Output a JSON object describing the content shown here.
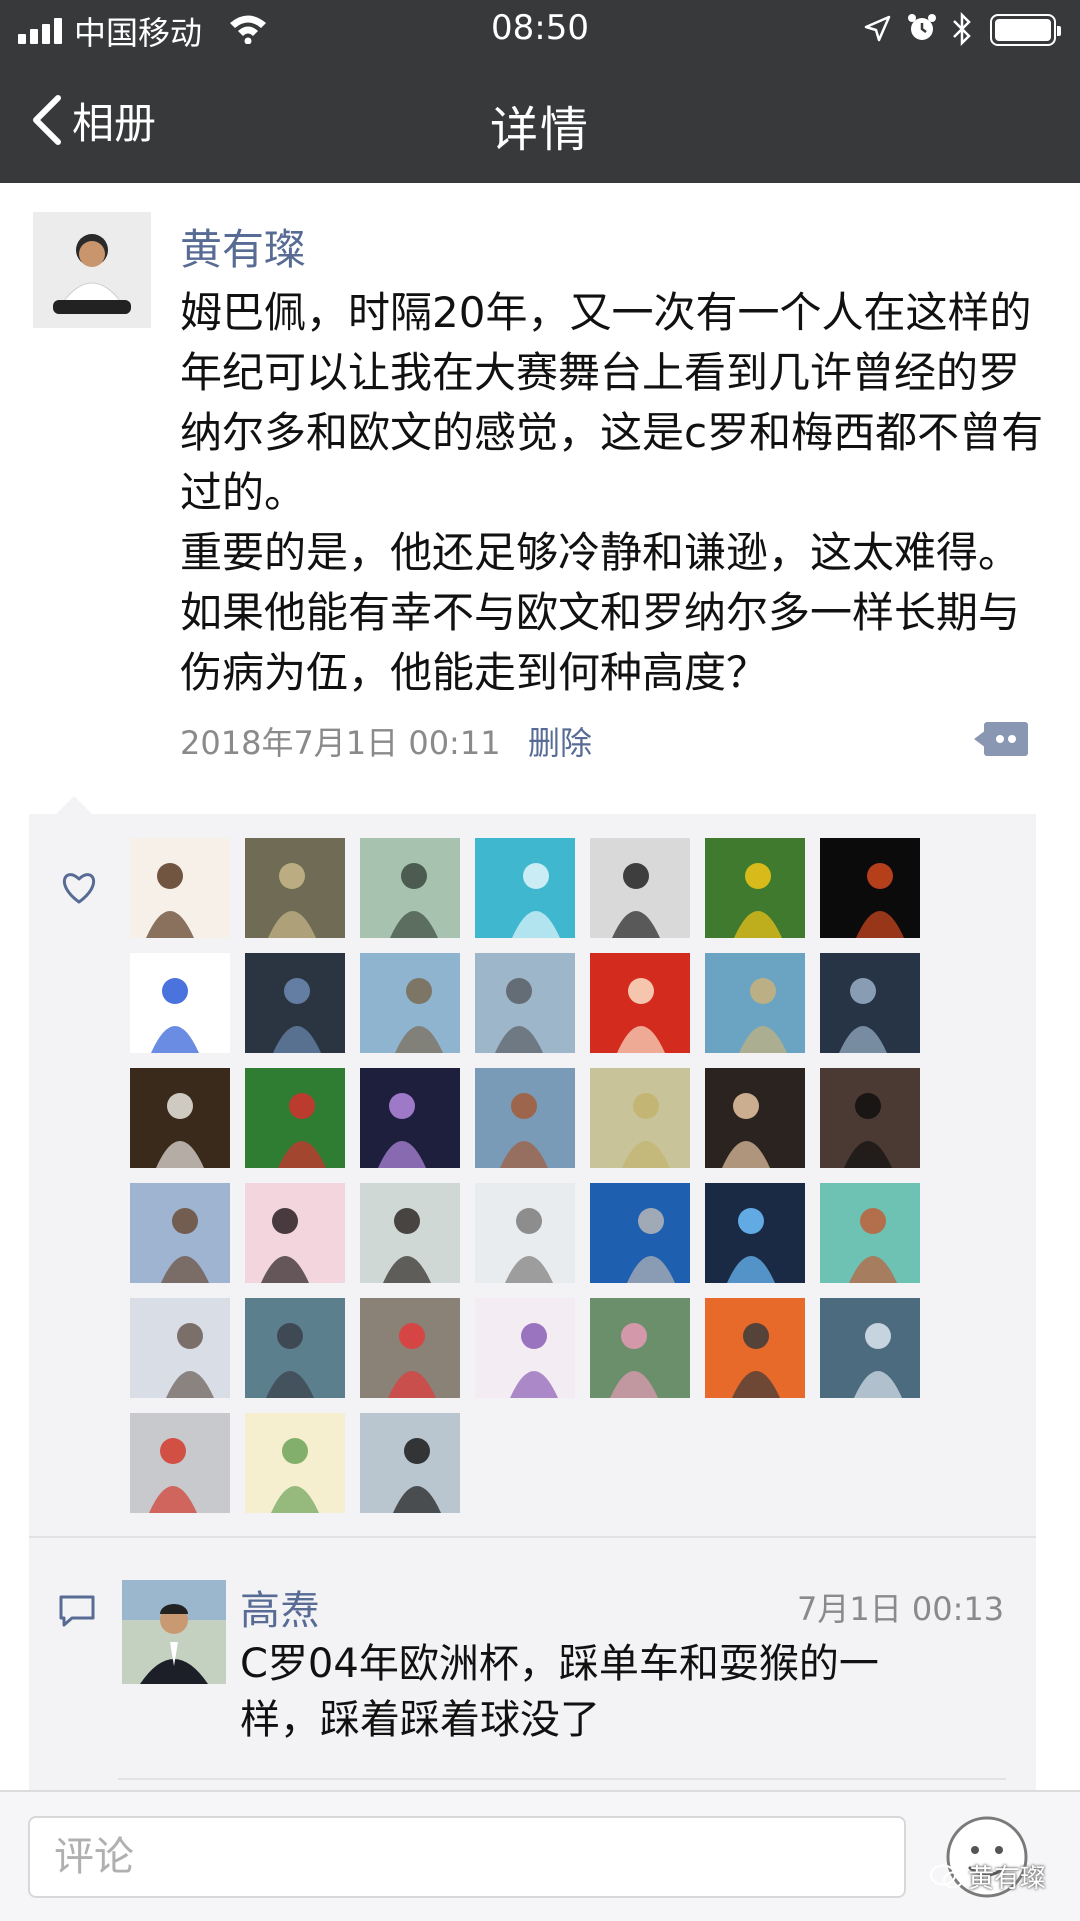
{
  "status_bar": {
    "carrier": "中国移动",
    "time": "08:50",
    "icons": [
      "signal-icon",
      "wifi-icon",
      "location-icon",
      "alarm-icon",
      "bluetooth-icon",
      "battery-icon"
    ]
  },
  "nav": {
    "back_label": "相册",
    "title": "详情"
  },
  "post": {
    "author": "黄有璨",
    "text": "姆巴佩，时隔20年，又一次有一个人在这样的年纪可以让我在大赛舞台上看到几许曾经的罗纳尔多和欧文的感觉，这是c罗和梅西都不曾有过的。\n重要的是，他还足够冷静和谦逊，这太难得。如果他能有幸不与欧文和罗纳尔多一样长期与伤病为伍，他能走到何种高度？",
    "timestamp": "2018年7月1日 00:11",
    "delete_label": "删除"
  },
  "likes": {
    "count": 38,
    "avatars": [
      {
        "bg": "#f7f0e8",
        "fg": "#5a3a22"
      },
      {
        "bg": "#6f6b55",
        "fg": "#c9b889"
      },
      {
        "bg": "#a7c3b0",
        "fg": "#3c4a3f"
      },
      {
        "bg": "#3fb7cf",
        "fg": "#e2f6fb"
      },
      {
        "bg": "#d9d9d9",
        "fg": "#222222"
      },
      {
        "bg": "#3f7a2e",
        "fg": "#f5c518"
      },
      {
        "bg": "#0b0b0b",
        "fg": "#d4481f"
      },
      {
        "bg": "#ffffff",
        "fg": "#2b5bd7"
      },
      {
        "bg": "#2b3542",
        "fg": "#6d8bb3"
      },
      {
        "bg": "#8fb4cf",
        "fg": "#7a6b54"
      },
      {
        "bg": "#9db6c9",
        "fg": "#5b5f66"
      },
      {
        "bg": "#d42b1f",
        "fg": "#fbe1c7"
      },
      {
        "bg": "#6aa4c2",
        "fg": "#c8b27a"
      },
      {
        "bg": "#263446",
        "fg": "#9ab0c7"
      },
      {
        "bg": "#3a2a1c",
        "fg": "#e9e6df"
      },
      {
        "bg": "#2f7d32",
        "fg": "#d32f2f"
      },
      {
        "bg": "#1d1f3c",
        "fg": "#b58ae0"
      },
      {
        "bg": "#7a9bb7",
        "fg": "#a35d3a"
      },
      {
        "bg": "#c9c39a",
        "fg": "#c2b46e"
      },
      {
        "bg": "#2a2320",
        "fg": "#e7c6a3"
      },
      {
        "bg": "#4a3a33",
        "fg": "#111111"
      },
      {
        "bg": "#9fb4d0",
        "fg": "#6b4d3b"
      },
      {
        "bg": "#f2d5dd",
        "fg": "#2a1f22"
      },
      {
        "bg": "#cfd8d4",
        "fg": "#2f2a27"
      },
      {
        "bg": "#e9ecee",
        "fg": "#7c7c7c"
      },
      {
        "bg": "#1e5fb0",
        "fg": "#b7b7b7"
      },
      {
        "bg": "#1a2a44",
        "fg": "#6ec1ff"
      },
      {
        "bg": "#6dc2b4",
        "fg": "#c0603a"
      },
      {
        "bg": "#d8dde6",
        "fg": "#6b5d52"
      },
      {
        "bg": "#5c7f8e",
        "fg": "#3a3f4a"
      },
      {
        "bg": "#8a8177",
        "fg": "#e23b3b"
      },
      {
        "bg": "#f4ecf3",
        "fg": "#8b5fb5"
      },
      {
        "bg": "#6b8f6b",
        "fg": "#e59bb5"
      },
      {
        "bg": "#e76a2b",
        "fg": "#3b3b3b"
      },
      {
        "bg": "#4c6b7f",
        "fg": "#dbe6ee"
      },
      {
        "bg": "#c7c9cc",
        "fg": "#d33a2c"
      },
      {
        "bg": "#f5efcf",
        "fg": "#6ea35a"
      },
      {
        "bg": "#b9c5cf",
        "fg": "#1a1a1a"
      }
    ]
  },
  "comment": {
    "author": "高焘",
    "time": "7月1日 00:13",
    "text": "C罗04年欧洲杯，踩单车和耍猴的一\n样，踩着踩着球没了"
  },
  "input": {
    "placeholder": "评论"
  },
  "watermark": {
    "text": "黄有璨"
  },
  "colors": {
    "nav_bg": "#38393b",
    "link_blue": "#576b95",
    "panel_bg": "#f3f3f5",
    "meta_gray": "#8a8a8a"
  }
}
